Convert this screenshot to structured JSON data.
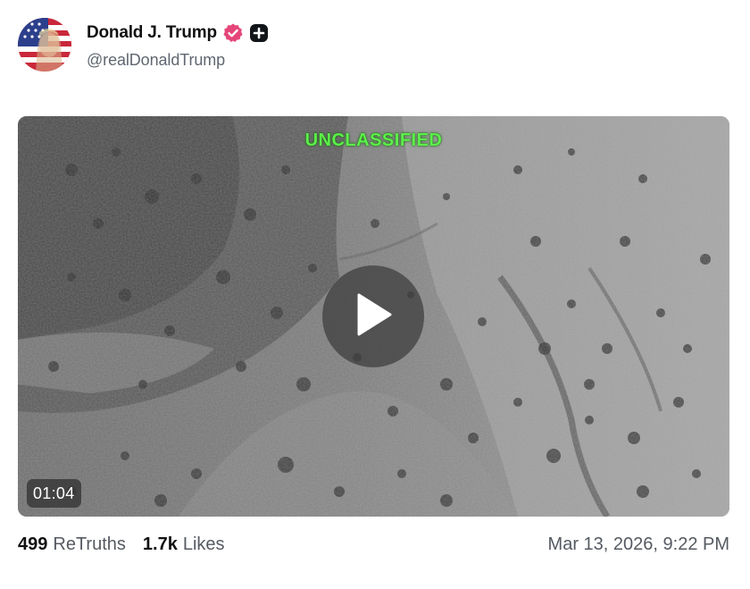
{
  "author": {
    "display_name": "Donald J. Trump",
    "handle": "@realDonaldTrump",
    "avatar_icon": "avatar-flag-portrait",
    "verified_icon": "verified-badge-icon",
    "verified_color": "#e5467a",
    "plus_icon": "plus-badge-icon"
  },
  "media": {
    "type": "video",
    "overlay_label": "UNCLASSIFIED",
    "overlay_color": "#5cf04a",
    "duration": "01:04",
    "play_icon": "play-icon"
  },
  "stats": {
    "retruths_count": "499",
    "retruths_label": "ReTruths",
    "likes_count": "1.7k",
    "likes_label": "Likes"
  },
  "timestamp": "Mar 13, 2026, 9:22 PM"
}
